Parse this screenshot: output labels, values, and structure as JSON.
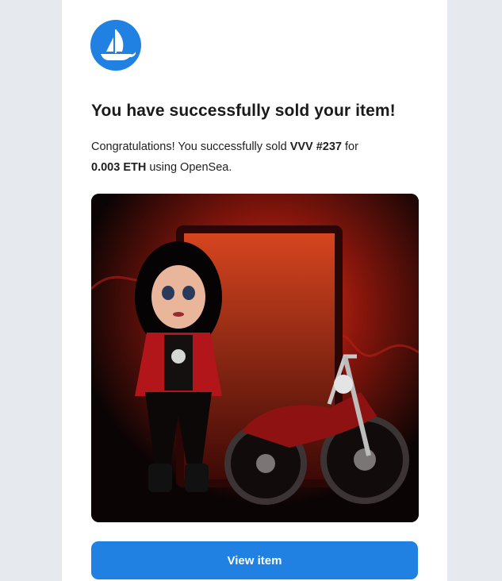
{
  "brand": {
    "logo_icon": "opensea-ship-icon",
    "accent_color": "#2081e2"
  },
  "email": {
    "title": "You have successfully sold your item!",
    "message": {
      "prefix": "Congratulations! You successfully sold",
      "item_name": "VVV #237",
      "middle": "for",
      "price": "0.003 ETH",
      "suffix": "using OpenSea."
    },
    "image_alt": "VVV #237",
    "button_label": "View item"
  }
}
